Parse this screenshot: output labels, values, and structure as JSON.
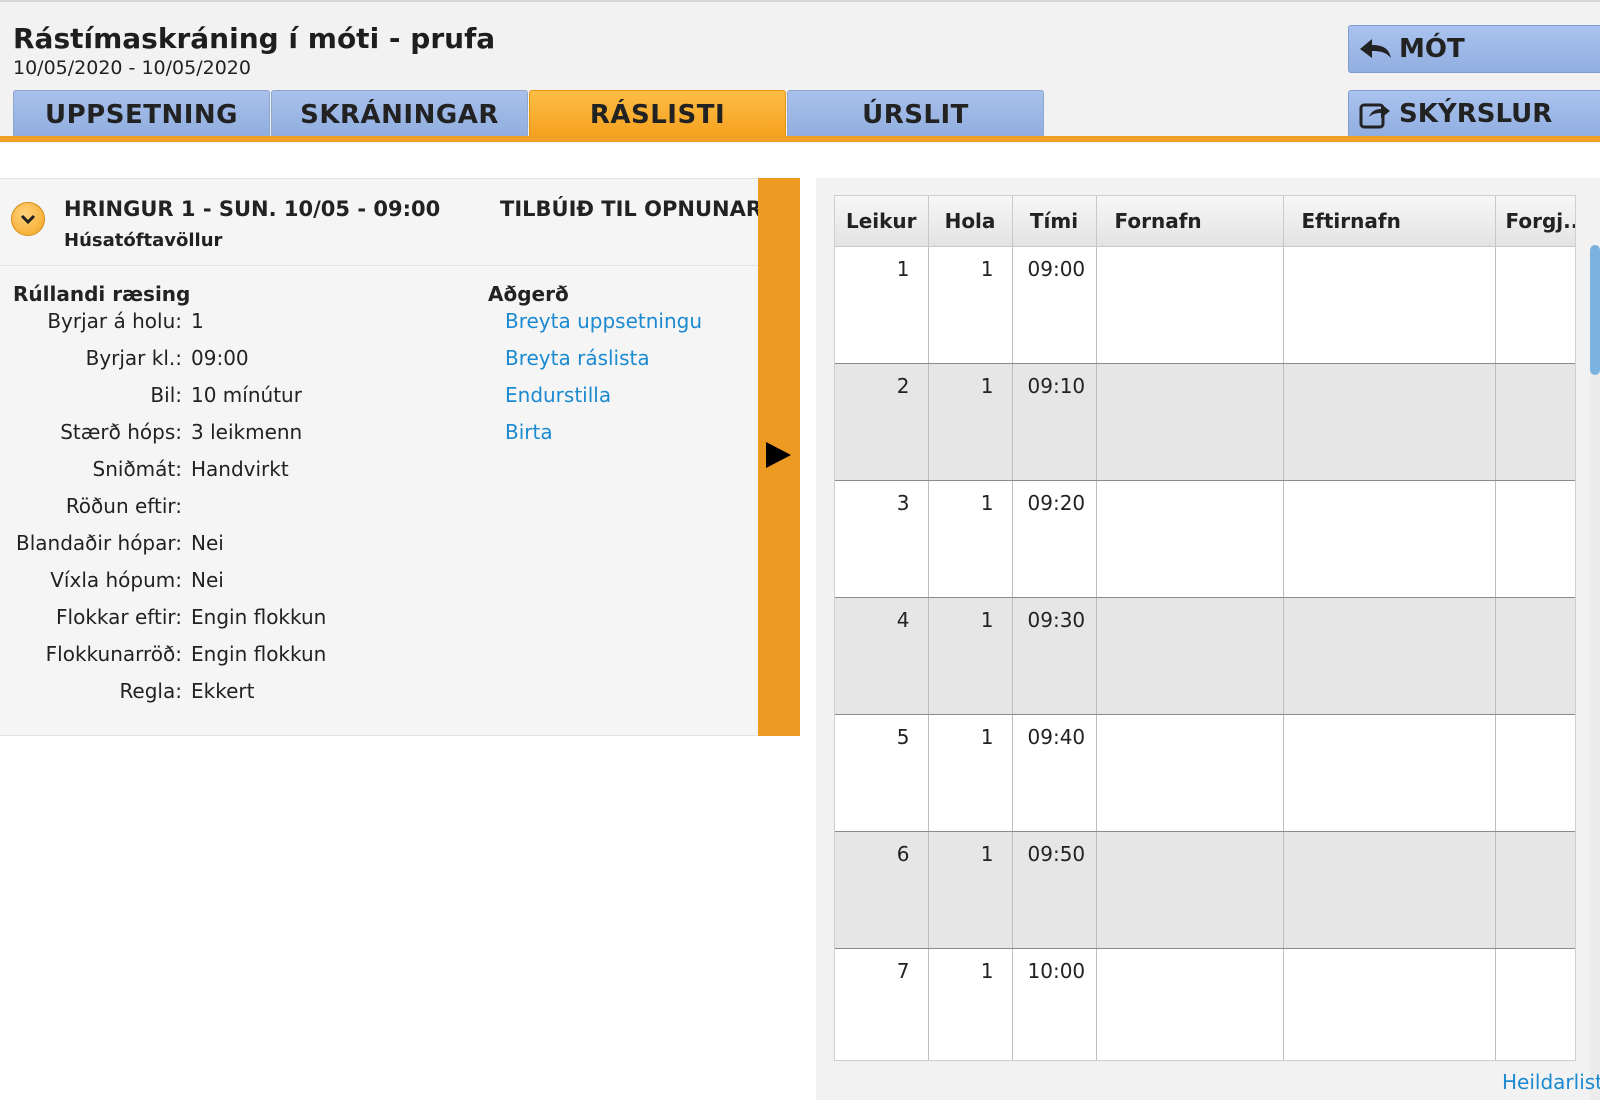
{
  "header": {
    "title": "Rástímaskráning í móti - prufa",
    "date_range": "10/05/2020 - 10/05/2020"
  },
  "tabs": [
    {
      "label": "UPPSETNING",
      "active": false
    },
    {
      "label": "SKRÁNINGAR",
      "active": false
    },
    {
      "label": "RÁSLISTI",
      "active": true
    },
    {
      "label": "ÚRSLIT",
      "active": false
    }
  ],
  "nav_buttons": {
    "mot_label": "MÓT",
    "skyrslur_label": "SKÝRSLUR"
  },
  "round": {
    "title": "HRINGUR 1 - SUN. 10/05 - 09:00",
    "course": "Húsatóftavöllur",
    "status": "TILBÚIÐ TIL OPNUNAR"
  },
  "settings": {
    "section_title": "Rúllandi ræsing",
    "rows": [
      {
        "label": "Byrjar á holu:",
        "value": "1"
      },
      {
        "label": "Byrjar kl.:",
        "value": "09:00"
      },
      {
        "label": "Bil:",
        "value": "10 mínútur"
      },
      {
        "label": "Stærð hóps:",
        "value": "3 leikmenn"
      },
      {
        "label": "Sniðmát:",
        "value": "Handvirkt"
      },
      {
        "label": "Röðun eftir:",
        "value": ""
      },
      {
        "label": "Blandaðir hópar:",
        "value": "Nei"
      },
      {
        "label": "Víxla hópum:",
        "value": "Nei"
      },
      {
        "label": "Flokkar eftir:",
        "value": "Engin flokkun"
      },
      {
        "label": "Flokkunarröð:",
        "value": "Engin flokkun"
      },
      {
        "label": "Regla:",
        "value": "Ekkert"
      }
    ]
  },
  "actions": {
    "section_title": "Aðgerð",
    "links": [
      "Breyta uppsetningu",
      "Breyta ráslista",
      "Endurstilla",
      "Birta"
    ]
  },
  "table": {
    "columns": [
      "Leikur",
      "Hola",
      "Tími",
      "Fornafn",
      "Eftirnafn",
      "Forgj..."
    ],
    "rows": [
      {
        "leikur": "1",
        "hola": "1",
        "timi": "09:00"
      },
      {
        "leikur": "2",
        "hola": "1",
        "timi": "09:10"
      },
      {
        "leikur": "3",
        "hola": "1",
        "timi": "09:20"
      },
      {
        "leikur": "4",
        "hola": "1",
        "timi": "09:30"
      },
      {
        "leikur": "5",
        "hola": "1",
        "timi": "09:40"
      },
      {
        "leikur": "6",
        "hola": "1",
        "timi": "09:50"
      },
      {
        "leikur": "7",
        "hola": "1",
        "timi": "10:00"
      }
    ]
  },
  "footer_link": "Heildarlisti",
  "colors": {
    "accent_orange": "#f0a024",
    "tab_blue": "#a9c1ec",
    "link_blue": "#1b8ad1"
  }
}
